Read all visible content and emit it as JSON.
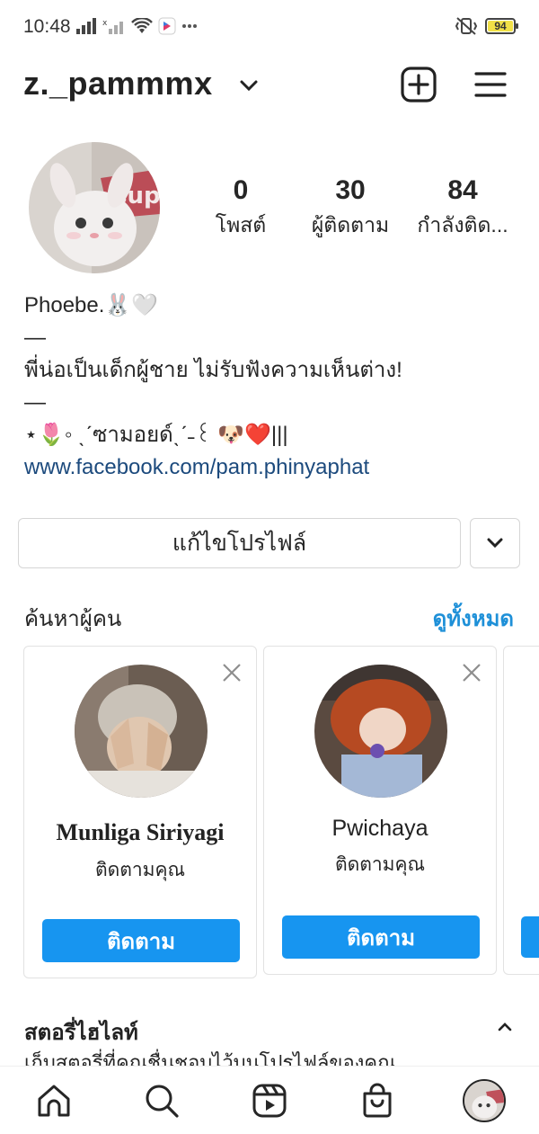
{
  "status_bar": {
    "time": "10:48",
    "battery": "94",
    "battery_level": 0.94,
    "icons": [
      "signal-icon",
      "signal-x-icon",
      "wifi-icon",
      "app-notification-icon",
      "more-icon",
      "vibrate-icon",
      "battery-icon"
    ]
  },
  "header": {
    "username": "z._pammmx",
    "icons": [
      "chevron-down-icon",
      "new-post-icon",
      "menu-icon"
    ]
  },
  "profile": {
    "stats": [
      {
        "value": "0",
        "label": "โพสต์"
      },
      {
        "value": "30",
        "label": "ผู้ติดตาม"
      },
      {
        "value": "84",
        "label": "กำลังติด..."
      }
    ],
    "bio_lines": [
      "Phoebe.🐰🤍",
      "—",
      "พี่น่อเป็นเด็กผู้ชาย ไม่รับฟังความเห็นต่าง!",
      "—",
      "⋆🌷◦ ˎˊซามอยด์ˎˊ˗꒰ 🐶❤️|||"
    ],
    "link": "www.facebook.com/pam.phinyaphat"
  },
  "edit_profile_label": "แก้ไขโปรไฟล์",
  "discover": {
    "title": "ค้นหาผู้คน",
    "see_all": "ดูทั้งหมด",
    "cards": [
      {
        "name": "Munliga Siriyagi",
        "subtitle": "ติดตามคุณ",
        "button": "ติดตาม"
      },
      {
        "name": "Pwichaya",
        "subtitle": "ติดตามคุณ",
        "button": "ติดตาม"
      }
    ]
  },
  "highlights": {
    "title": "สตอรี่ไฮไลท์",
    "subtitle": "เก็บสตอรี่ที่คุณชื่นชอบไว้บนโปรไฟล์ของคุณ"
  },
  "bottom_nav": [
    "home-icon",
    "search-icon",
    "reels-icon",
    "shop-icon",
    "profile-avatar"
  ],
  "colors": {
    "accent": "#1795f0",
    "link": "#1c4a7d",
    "see_all": "#1e90d8",
    "text": "#262626",
    "border": "#d6d6d6"
  }
}
